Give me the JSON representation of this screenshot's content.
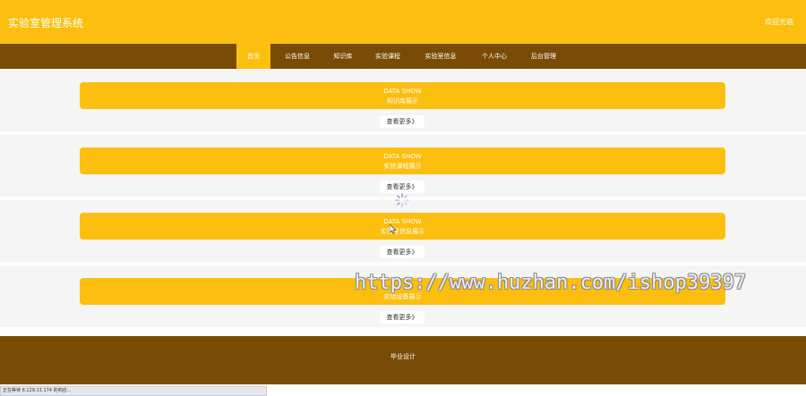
{
  "header": {
    "title": "实验室管理系统",
    "welcome": "欢迎光临"
  },
  "nav": {
    "items": [
      {
        "label": "首页",
        "active": true
      },
      {
        "label": "公告信息"
      },
      {
        "label": "知识库"
      },
      {
        "label": "实验课程"
      },
      {
        "label": "实验室信息"
      },
      {
        "label": "个人中心"
      },
      {
        "label": "后台管理"
      }
    ]
  },
  "sections": [
    {
      "title": "DATA SHOW",
      "subtitle": "知识库展示",
      "more": "查看更多》"
    },
    {
      "title": "DATA SHOW",
      "subtitle": "实验课程展示",
      "more": "查看更多》"
    },
    {
      "title": "DATA SHOW",
      "subtitle": "实验室信息展示",
      "more": "查看更多》"
    },
    {
      "title": "",
      "subtitle": "实验设备展示",
      "more": "查看更多》"
    }
  ],
  "footer": {
    "text": "毕业设计"
  },
  "statusbar": {
    "text": "正在等待 8.129.13.174 的响应..."
  },
  "watermark": {
    "text": "https://www.huzhan.com/ishop39397"
  },
  "colors": {
    "primary": "#fdbf0f",
    "dark": "#7a4b04",
    "section_bg": "#f5f5f5"
  }
}
